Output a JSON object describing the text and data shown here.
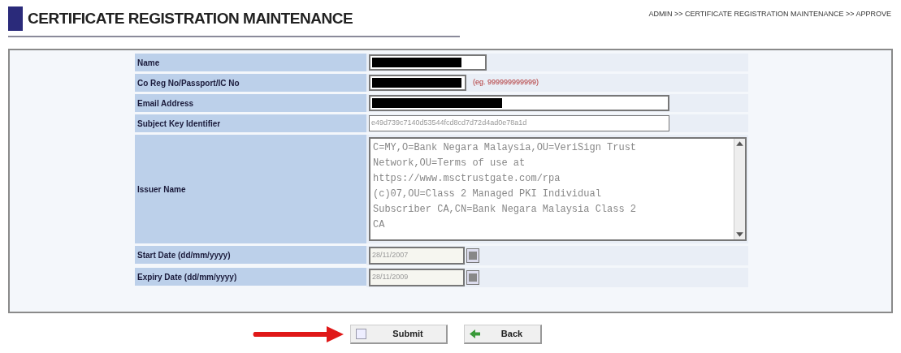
{
  "header": {
    "title": "CERTIFICATE REGISTRATION MAINTENANCE",
    "breadcrumb": "ADMIN >> CERTIFICATE REGISTRATION MAINTENANCE >> APPROVE"
  },
  "fields": [
    {
      "kind": "redacted",
      "label": "Name"
    },
    {
      "kind": "redacted",
      "label": "Co Reg No/Passport/IC No",
      "hint": "(eg. 999999999999)"
    },
    {
      "kind": "redacted",
      "label": "Email Address"
    },
    {
      "kind": "text",
      "label": "Subject Key Identifier",
      "value": "e49d739c7140d53544fcd8cd7d72d4ad0e78a1d"
    },
    {
      "kind": "textarea",
      "label": "Issuer Name",
      "value": "C=MY,O=Bank Negara Malaysia,OU=VeriSign Trust Network,OU=Terms of use at https://www.msctrustgate.com/rpa (c)07,OU=Class 2 Managed PKI Individual Subscriber CA,CN=Bank Negara Malaysia Class 2 CA"
    },
    {
      "kind": "date",
      "label": "Start Date (dd/mm/yyyy)",
      "value": "28/11/2007"
    },
    {
      "kind": "date",
      "label": "Expiry Date (dd/mm/yyyy)",
      "value": "28/11/2009"
    }
  ],
  "buttons": [
    {
      "kind": "submit",
      "label": "Submit"
    },
    {
      "kind": "back",
      "label": "Back"
    }
  ]
}
